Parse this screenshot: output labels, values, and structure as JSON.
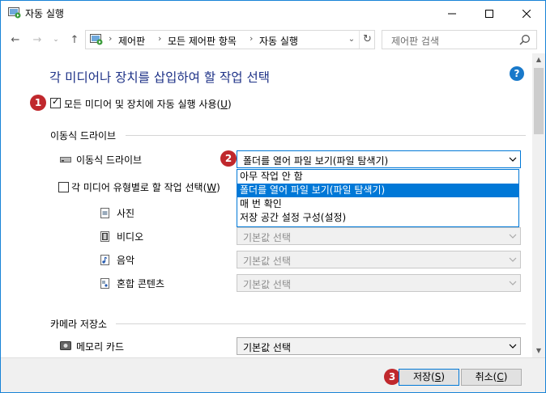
{
  "window": {
    "title": "자동 실행",
    "minimize": "—",
    "maximize": "☐",
    "close": "✕"
  },
  "nav": {
    "back": "←",
    "forward": "→",
    "recent": "⌄",
    "up": "↑",
    "breadcrumbs": [
      "제어판",
      "모든 제어판 항목",
      "자동 실행"
    ],
    "separator": "›",
    "refresh": "↻",
    "dropdown": "⌄",
    "search_placeholder": "제어판 검색"
  },
  "main": {
    "heading": "각 미디어나 장치를 삽입하여 할 작업 선택",
    "help": "?",
    "use_autoplay": {
      "label": "모든 미디어 및 장치에 자동 실행 사용(",
      "accel": "U",
      "suffix": ")",
      "checked": true
    },
    "removable_section": {
      "title": "이동식 드라이브",
      "drive_label": "이동식 드라이브",
      "drive_value": "폴더를 열어 파일 보기(파일 탐색기)",
      "options": [
        "아무 작업 안 함",
        "폴더를 열어 파일 보기(파일 탐색기)",
        "매 번 확인",
        "저장 공간 설정 구성(설정)"
      ],
      "selected_index": 1,
      "per_media": {
        "label": "각 미디어 유형별로 할 작업 선택(",
        "accel": "W",
        "suffix": ")",
        "checked": false
      },
      "media": [
        {
          "label": "사진",
          "value": "기본값 선택",
          "icon": "picture-icon"
        },
        {
          "label": "비디오",
          "value": "기본값 선택",
          "icon": "video-icon"
        },
        {
          "label": "음악",
          "value": "기본값 선택",
          "icon": "music-icon"
        },
        {
          "label": "혼합 콘텐츠",
          "value": "기본값 선택",
          "icon": "mixed-content-icon"
        }
      ]
    },
    "camera_section": {
      "title": "카메라 저장소",
      "memory_card_label": "메모리 카드",
      "memory_card_value": "기본값 선택"
    }
  },
  "badges": [
    "1",
    "2",
    "3"
  ],
  "footer": {
    "save": "저장(",
    "save_accel": "S",
    "save_suffix": ")",
    "cancel": "취소(",
    "cancel_accel": "C",
    "cancel_suffix": ")"
  },
  "colors": {
    "heading": "#1e3287",
    "accent": "#0078d7",
    "badge": "#c0282d",
    "help": "#1979ca"
  }
}
